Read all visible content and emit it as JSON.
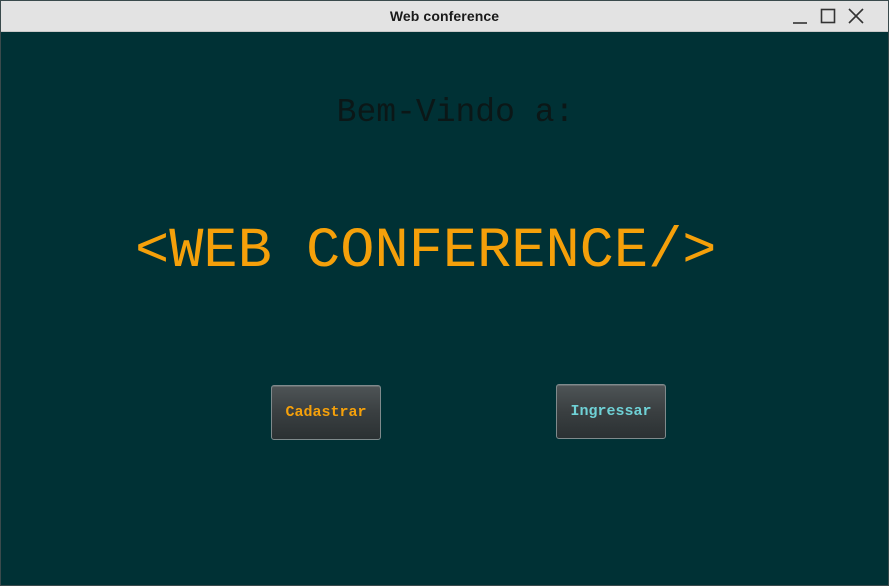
{
  "window": {
    "title": "Web conference",
    "controls": {
      "minimize": "minimize-icon",
      "maximize": "maximize-icon",
      "close": "close-icon"
    }
  },
  "main": {
    "welcome_text": "Bem-Vindo a:",
    "brand_text": "<WEB CONFERENCE/>",
    "buttons": {
      "register_label": "Cadastrar",
      "login_label": "Ingressar"
    }
  },
  "colors": {
    "background": "#003135",
    "brand": "#f5a00a",
    "login_text": "#6fd1d6",
    "welcome_text": "#0b1717"
  }
}
